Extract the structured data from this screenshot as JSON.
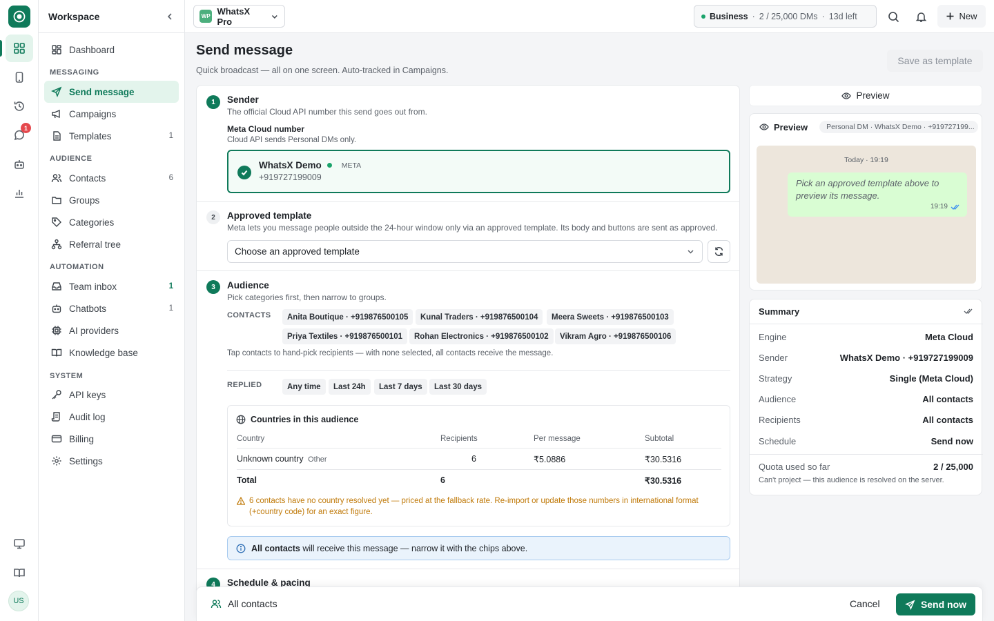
{
  "rail": {
    "avatar_initials": "US",
    "chat_badge": "1"
  },
  "sidebar": {
    "title": "Workspace",
    "sections": {
      "messaging": "MESSAGING",
      "audience": "AUDIENCE",
      "automation": "AUTOMATION",
      "system": "SYSTEM"
    },
    "items": {
      "dashboard": {
        "label": "Dashboard"
      },
      "send_message": {
        "label": "Send message"
      },
      "campaigns": {
        "label": "Campaigns"
      },
      "templates": {
        "label": "Templates",
        "count": "1"
      },
      "contacts": {
        "label": "Contacts",
        "count": "6"
      },
      "groups": {
        "label": "Groups"
      },
      "categories": {
        "label": "Categories"
      },
      "referral_tree": {
        "label": "Referral tree"
      },
      "team_inbox": {
        "label": "Team inbox",
        "count": "1"
      },
      "chatbots": {
        "label": "Chatbots",
        "count": "1"
      },
      "ai_providers": {
        "label": "AI providers"
      },
      "knowledge_base": {
        "label": "Knowledge base"
      },
      "api_keys": {
        "label": "API keys"
      },
      "audit_log": {
        "label": "Audit log"
      },
      "billing": {
        "label": "Billing"
      },
      "settings": {
        "label": "Settings"
      }
    }
  },
  "topbar": {
    "workspace_badge": "WP",
    "workspace_name": "WhatsX Pro",
    "plan_name": "Business",
    "plan_dms": "2 / 25,000 DMs",
    "plan_left": "13d left",
    "new_label": "New"
  },
  "page": {
    "title": "Send message",
    "subtitle": "Quick broadcast — all on one screen. Auto-tracked in Campaigns.",
    "save_template": "Save as template"
  },
  "sender": {
    "step": "1",
    "title": "Sender",
    "desc": "The official Cloud API number this send goes out from.",
    "field_label": "Meta Cloud number",
    "field_desc": "Cloud API sends Personal DMs only.",
    "account_name": "WhatsX Demo",
    "account_tag": "META",
    "account_number": "+919727199009"
  },
  "template": {
    "step": "2",
    "title": "Approved template",
    "desc": "Meta lets you message people outside the 24-hour window only via an approved template. Its body and buttons are sent as approved.",
    "select_value": "Choose an approved template"
  },
  "audience": {
    "step": "3",
    "title": "Audience",
    "desc": "Pick categories first, then narrow to groups.",
    "contacts_label": "CONTACTS",
    "contacts": [
      "Anita Boutique · +919876500105",
      "Kunal Traders · +919876500104",
      "Meera Sweets · +919876500103",
      "Priya Textiles · +919876500101",
      "Rohan Electronics · +919876500102",
      "Vikram Agro · +919876500106"
    ],
    "contacts_hint": "Tap contacts to hand-pick recipients — with none selected, all contacts receive the message.",
    "replied_label": "REPLIED",
    "replied_options": [
      "Any time",
      "Last 24h",
      "Last 7 days",
      "Last 30 days"
    ],
    "countries": {
      "title": "Countries in this audience",
      "headers": {
        "country": "Country",
        "recipients": "Recipients",
        "per_message": "Per message",
        "subtotal": "Subtotal"
      },
      "row": {
        "country": "Unknown country",
        "tag": "Other",
        "recipients": "6",
        "per_message": "₹5.0886",
        "subtotal": "₹30.5316"
      },
      "total": {
        "label": "Total",
        "recipients": "6",
        "subtotal": "₹30.5316"
      },
      "warning": "6 contacts have no country resolved yet — priced at the fallback rate. Re-import or update those numbers in international format (+country code) for an exact figure."
    },
    "info_bold": "All contacts",
    "info_rest": " will receive this message — narrow it with the chips above."
  },
  "schedule": {
    "step": "4",
    "title": "Schedule & pacing"
  },
  "preview": {
    "tab_label": "Preview",
    "card_title": "Preview",
    "context": "Personal DM · WhatsX Demo · +919727199...",
    "date_stamp": "Today · 19:19",
    "placeholder": "Pick an approved template above to preview its message.",
    "time": "19:19"
  },
  "summary": {
    "title": "Summary",
    "rows": [
      {
        "k": "Engine",
        "v": "Meta Cloud"
      },
      {
        "k": "Sender",
        "v": "WhatsX Demo · +919727199009"
      },
      {
        "k": "Strategy",
        "v": "Single (Meta Cloud)"
      },
      {
        "k": "Audience",
        "v": "All contacts"
      },
      {
        "k": "Recipients",
        "v": "All contacts"
      },
      {
        "k": "Schedule",
        "v": "Send now"
      }
    ],
    "quota_label": "Quota used so far",
    "quota_value": "2 / 25,000",
    "quota_note": "Can't project — this audience is resolved on the server."
  },
  "footer": {
    "audience": "All contacts",
    "cancel": "Cancel",
    "send": "Send now"
  },
  "colors": {
    "accent": "#0f7a5a",
    "accent_light": "#e3f4ec",
    "warning": "#c07a0a",
    "danger": "#e5484d"
  }
}
